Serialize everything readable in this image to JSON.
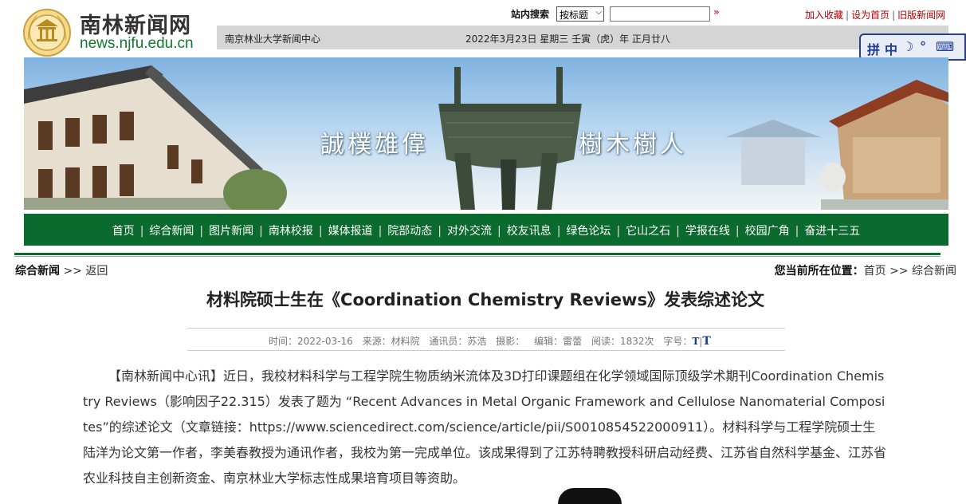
{
  "header": {
    "site_name": "南林新闻网",
    "site_url": "news.njfu.edu.cn",
    "search": {
      "label": "站内搜索",
      "scope": "按标题",
      "query": "",
      "go_glyph": "»"
    },
    "links": [
      "加入收藏",
      "设为首页",
      "旧版新闻网"
    ],
    "org_name": "南京林业大学新闻中心",
    "date_text": "2022年3月23日 星期三 壬寅（虎）年 正月廿八"
  },
  "ime": {
    "icons": [
      "拼",
      "中",
      "☽",
      "°",
      "⌨"
    ]
  },
  "banner": {
    "slogans": [
      "誠樸雄偉",
      "樹木樹人"
    ]
  },
  "nav": {
    "items": [
      "首页",
      "综合新闻",
      "图片新闻",
      "南林校报",
      "媒体报道",
      "院部动态",
      "对外交流",
      "校友讯息",
      "绿色论坛",
      "它山之石",
      "学报在线",
      "校园广角",
      "奋进十三五"
    ]
  },
  "breadcrumb": {
    "section": "综合新闻",
    "back_prefix": ">>",
    "back_label": "返回",
    "location_label": "您当前所在位置：",
    "home": "首页",
    "arrow": ">>",
    "current": "综合新闻"
  },
  "article": {
    "title": "材料院硕士生在《Coordination Chemistry Reviews》发表综述论文",
    "meta": {
      "time": "时间：2022-03-16",
      "source": "来源：材料院",
      "reporter": "通讯员：苏浩",
      "photo": "摄影：",
      "editor": "编辑：雷蕾",
      "views": "阅读：1832次",
      "fontsize_label": "字号：",
      "fs_small": "T",
      "fs_sep": "|",
      "fs_large": "T"
    },
    "body": "【南林新闻中心讯】近日，我校材料科学与工程学院生物质纳米流体及3D打印课题组在化学领域国际顶级学术期刊Coordination Chemistry Reviews（影响因子22.315）发表了题为 “Recent Advances in Metal Organic Framework and Cellulose Nanomaterial Composites”的综述论文（文章链接：https://www.sciencedirect.com/science/article/pii/S0010854522000911）。材料科学与工程学院硕士生陆洋为论文第一作者，李美春教授为通讯作者，我校为第一完成单位。该成果得到了江苏特聘教授科研启动经费、江苏省自然科学基金、江苏省农业科技自主创新资金、南京林业大学标志性成果培育项目等资助。"
  },
  "colors": {
    "nav_green": "#0b6a2e",
    "logo_url_green": "#0e7b2f",
    "toplink_red": "#b00000",
    "infobar_gray": "#d5d5d5"
  }
}
